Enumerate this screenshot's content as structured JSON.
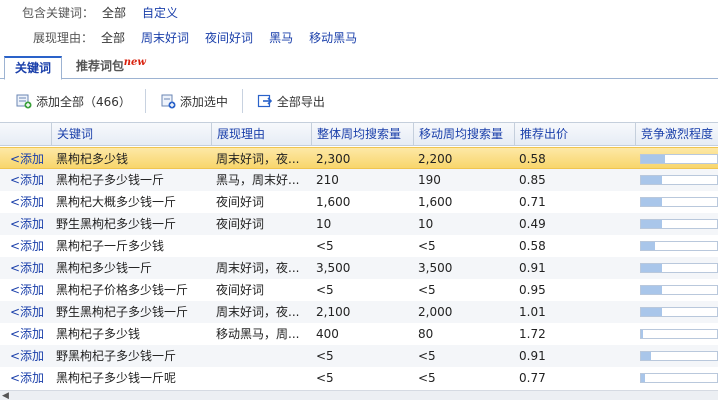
{
  "filters": {
    "keyword": {
      "label": "包含关键词：",
      "options": [
        "全部",
        "自定义"
      ]
    },
    "reason": {
      "label": "展现理由：",
      "options": [
        "全部",
        "周末好词",
        "夜间好词",
        "黑马",
        "移动黑马"
      ]
    }
  },
  "tabs": [
    {
      "label": "关键词"
    },
    {
      "label": "推荐词包",
      "badge": "new"
    }
  ],
  "toolbar": {
    "add_all": "添加全部（466）",
    "add_selected": "添加选中",
    "export_all": "全部导出"
  },
  "table": {
    "columns": [
      "关键词",
      "展现理由",
      "整体周均搜索量",
      "移动周均搜索量",
      "推荐出价",
      "竞争激烈程度"
    ],
    "add_label": "<添加",
    "rows": [
      {
        "keyword": "黑枸杞多少钱",
        "reason": "周末好词，夜...",
        "total": "2,300",
        "mobile": "2,200",
        "bid": "0.58",
        "competition": 0.32
      },
      {
        "keyword": "黑枸杞子多少钱一斤",
        "reason": "黑马，周末好...",
        "total": "210",
        "mobile": "190",
        "bid": "0.85",
        "competition": 0.27
      },
      {
        "keyword": "黑枸杞大概多少钱一斤",
        "reason": "夜间好词",
        "total": "1,600",
        "mobile": "1,600",
        "bid": "0.71",
        "competition": 0.27
      },
      {
        "keyword": "野生黑枸杞多少钱一斤",
        "reason": "夜间好词",
        "total": "10",
        "mobile": "10",
        "bid": "0.49",
        "competition": 0.27
      },
      {
        "keyword": "黑枸杞子一斤多少钱",
        "reason": "",
        "total": "<5",
        "mobile": "<5",
        "bid": "0.58",
        "competition": 0.19
      },
      {
        "keyword": "黑枸杞多少钱一斤",
        "reason": "周末好词，夜...",
        "total": "3,500",
        "mobile": "3,500",
        "bid": "0.91",
        "competition": 0.27
      },
      {
        "keyword": "黑枸杞子价格多少钱一斤",
        "reason": "夜间好词",
        "total": "<5",
        "mobile": "<5",
        "bid": "0.95",
        "competition": 0.27
      },
      {
        "keyword": "野生黑枸杞子多少钱一斤",
        "reason": "周末好词，夜...",
        "total": "2,100",
        "mobile": "2,000",
        "bid": "1.01",
        "competition": 0.27
      },
      {
        "keyword": "黑枸杞子多少钱",
        "reason": "移动黑马，周...",
        "total": "400",
        "mobile": "80",
        "bid": "1.72",
        "competition": 0.03
      },
      {
        "keyword": "野黑枸杞子多少钱一斤",
        "reason": "",
        "total": "<5",
        "mobile": "<5",
        "bid": "0.91",
        "competition": 0.13
      },
      {
        "keyword": "黑枸杞子多少钱一斤呢",
        "reason": "",
        "total": "<5",
        "mobile": "<5",
        "bid": "0.77",
        "competition": 0.05
      }
    ]
  },
  "colors": {
    "link": "#1a3faa",
    "selected_row": "#f8d66c",
    "bar": "#a9c6ea",
    "badge": "#d8200d"
  }
}
